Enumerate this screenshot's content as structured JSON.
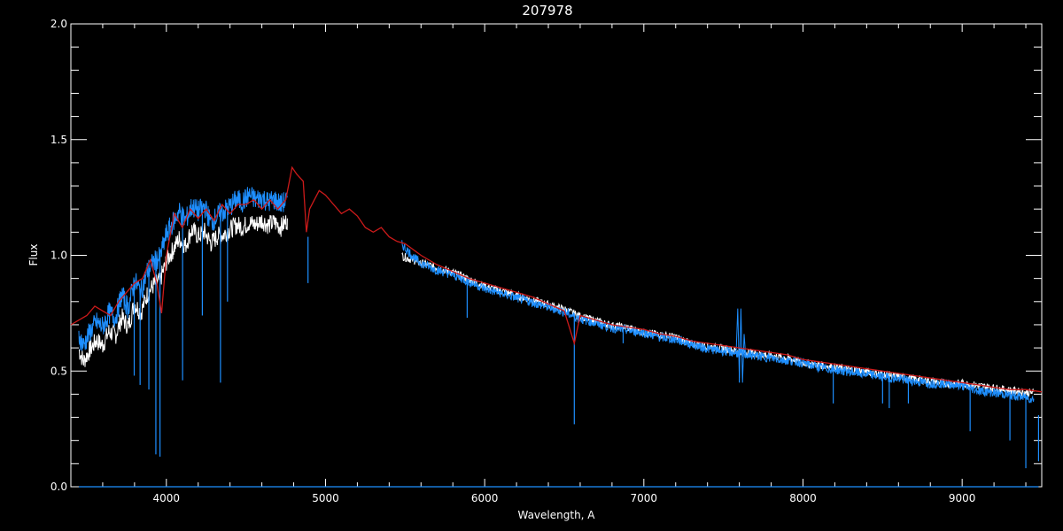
{
  "chart_data": {
    "type": "line",
    "title": "207978",
    "xlabel": "Wavelength, A",
    "ylabel": "Flux",
    "xlim": [
      3400,
      9500
    ],
    "ylim": [
      0.0,
      2.0
    ],
    "x_ticks": [
      4000,
      5000,
      6000,
      7000,
      8000,
      9000
    ],
    "x_tick_labels": [
      "4000",
      "5000",
      "6000",
      "7000",
      "8000",
      "9000"
    ],
    "y_ticks": [
      0.0,
      0.5,
      1.0,
      1.5,
      2.0
    ],
    "y_tick_labels": [
      "0.0",
      "0.5",
      "1.0",
      "1.5",
      "2.0"
    ],
    "grid": false,
    "background": "#000000",
    "series": [
      {
        "color": "#ffffff",
        "segments": [
          [
            [
              3450,
              0.6
            ],
            [
              3480,
              0.55
            ],
            [
              3520,
              0.6
            ],
            [
              3560,
              0.64
            ],
            [
              3600,
              0.62
            ],
            [
              3640,
              0.68
            ],
            [
              3680,
              0.66
            ],
            [
              3720,
              0.74
            ],
            [
              3760,
              0.7
            ],
            [
              3800,
              0.8
            ],
            [
              3840,
              0.76
            ],
            [
              3880,
              0.84
            ],
            [
              3920,
              0.88
            ],
            [
              3960,
              0.9
            ],
            [
              4000,
              0.98
            ],
            [
              4040,
              1.03
            ],
            [
              4080,
              1.08
            ],
            [
              4120,
              1.05
            ],
            [
              4160,
              1.12
            ],
            [
              4200,
              1.09
            ],
            [
              4240,
              1.11
            ],
            [
              4280,
              1.06
            ],
            [
              4320,
              1.09
            ],
            [
              4360,
              1.1
            ],
            [
              4400,
              1.12
            ],
            [
              4440,
              1.14
            ],
            [
              4480,
              1.13
            ],
            [
              4520,
              1.15
            ],
            [
              4560,
              1.14
            ],
            [
              4600,
              1.16
            ],
            [
              4640,
              1.14
            ],
            [
              4680,
              1.15
            ],
            [
              4720,
              1.13
            ],
            [
              4760,
              1.16
            ]
          ],
          [
            [
              5480,
              1.0
            ],
            [
              5520,
              0.99
            ],
            [
              5560,
              0.98
            ],
            [
              5600,
              0.97
            ],
            [
              5700,
              0.95
            ],
            [
              5800,
              0.93
            ],
            [
              5900,
              0.9
            ],
            [
              6000,
              0.87
            ],
            [
              6100,
              0.85
            ],
            [
              6200,
              0.83
            ],
            [
              6300,
              0.81
            ],
            [
              6400,
              0.79
            ],
            [
              6500,
              0.77
            ],
            [
              6600,
              0.74
            ],
            [
              6700,
              0.72
            ],
            [
              6800,
              0.7
            ],
            [
              6900,
              0.69
            ],
            [
              7000,
              0.67
            ],
            [
              7100,
              0.66
            ],
            [
              7200,
              0.65
            ],
            [
              7300,
              0.62
            ],
            [
              7400,
              0.61
            ],
            [
              7500,
              0.6
            ],
            [
              7600,
              0.59
            ],
            [
              7700,
              0.58
            ],
            [
              7800,
              0.57
            ],
            [
              7900,
              0.56
            ],
            [
              8000,
              0.54
            ],
            [
              8100,
              0.53
            ],
            [
              8200,
              0.52
            ],
            [
              8300,
              0.51
            ],
            [
              8400,
              0.5
            ],
            [
              8500,
              0.49
            ],
            [
              8600,
              0.48
            ],
            [
              8700,
              0.47
            ],
            [
              8800,
              0.46
            ],
            [
              8900,
              0.45
            ],
            [
              9000,
              0.45
            ],
            [
              9100,
              0.44
            ],
            [
              9200,
              0.43
            ],
            [
              9300,
              0.42
            ],
            [
              9400,
              0.41
            ],
            [
              9450,
              0.41
            ]
          ]
        ]
      },
      {
        "color": "#1e8fff",
        "segments": [
          [
            [
              3450,
              0.66
            ],
            [
              3480,
              0.62
            ],
            [
              3520,
              0.68
            ],
            [
              3560,
              0.72
            ],
            [
              3600,
              0.7
            ],
            [
              3640,
              0.76
            ],
            [
              3680,
              0.74
            ],
            [
              3720,
              0.84
            ],
            [
              3760,
              0.78
            ],
            [
              3800,
              0.9
            ],
            [
              3840,
              0.85
            ],
            [
              3880,
              0.94
            ],
            [
              3920,
              0.98
            ],
            [
              3960,
              1.0
            ],
            [
              4000,
              1.1
            ],
            [
              4040,
              1.15
            ],
            [
              4080,
              1.2
            ],
            [
              4120,
              1.16
            ],
            [
              4160,
              1.22
            ],
            [
              4200,
              1.2
            ],
            [
              4240,
              1.22
            ],
            [
              4280,
              1.15
            ],
            [
              4320,
              1.18
            ],
            [
              4360,
              1.2
            ],
            [
              4400,
              1.22
            ],
            [
              4440,
              1.25
            ],
            [
              4480,
              1.24
            ],
            [
              4520,
              1.27
            ],
            [
              4560,
              1.25
            ],
            [
              4600,
              1.26
            ],
            [
              4640,
              1.24
            ],
            [
              4680,
              1.25
            ],
            [
              4720,
              1.23
            ],
            [
              4760,
              1.25
            ]
          ],
          [
            [
              5480,
              1.05
            ],
            [
              5520,
              1.02
            ],
            [
              5560,
              0.99
            ],
            [
              5600,
              0.97
            ],
            [
              5700,
              0.94
            ],
            [
              5800,
              0.92
            ],
            [
              5900,
              0.89
            ],
            [
              6000,
              0.86
            ],
            [
              6100,
              0.84
            ],
            [
              6200,
              0.82
            ],
            [
              6300,
              0.8
            ],
            [
              6400,
              0.78
            ],
            [
              6500,
              0.76
            ],
            [
              6560,
              0.74
            ],
            [
              6600,
              0.73
            ],
            [
              6700,
              0.71
            ],
            [
              6800,
              0.69
            ],
            [
              6900,
              0.68
            ],
            [
              7000,
              0.67
            ],
            [
              7100,
              0.65
            ],
            [
              7200,
              0.64
            ],
            [
              7300,
              0.62
            ],
            [
              7400,
              0.6
            ],
            [
              7500,
              0.59
            ],
            [
              7600,
              0.58
            ],
            [
              7700,
              0.57
            ],
            [
              7800,
              0.56
            ],
            [
              7900,
              0.55
            ],
            [
              8000,
              0.54
            ],
            [
              8100,
              0.52
            ],
            [
              8200,
              0.51
            ],
            [
              8300,
              0.5
            ],
            [
              8400,
              0.49
            ],
            [
              8500,
              0.48
            ],
            [
              8600,
              0.47
            ],
            [
              8700,
              0.46
            ],
            [
              8800,
              0.45
            ],
            [
              8900,
              0.45
            ],
            [
              9000,
              0.44
            ],
            [
              9100,
              0.42
            ],
            [
              9200,
              0.41
            ],
            [
              9300,
              0.4
            ],
            [
              9400,
              0.39
            ],
            [
              9450,
              0.38
            ]
          ]
        ],
        "dips": [
          [
            3960,
            0.13
          ],
          [
            3934,
            0.14
          ],
          [
            4102,
            0.46
          ],
          [
            4340,
            0.45
          ],
          [
            3890,
            0.42
          ],
          [
            3835,
            0.44
          ],
          [
            3798,
            0.48
          ],
          [
            4226,
            0.74
          ],
          [
            4384,
            0.8
          ],
          [
            4890,
            0.88
          ],
          [
            5890,
            0.73
          ],
          [
            6563,
            0.27
          ],
          [
            6870,
            0.62
          ],
          [
            7600,
            0.45
          ],
          [
            8190,
            0.36
          ],
          [
            8500,
            0.36
          ],
          [
            8542,
            0.34
          ],
          [
            8662,
            0.36
          ],
          [
            9050,
            0.24
          ],
          [
            9300,
            0.2
          ],
          [
            9400,
            0.08
          ],
          [
            9480,
            0.11
          ]
        ],
        "baseline": 0.0
      },
      {
        "color": "#cc1a1a",
        "points": [
          [
            3400,
            0.7
          ],
          [
            3450,
            0.72
          ],
          [
            3500,
            0.74
          ],
          [
            3550,
            0.78
          ],
          [
            3600,
            0.76
          ],
          [
            3650,
            0.74
          ],
          [
            3700,
            0.8
          ],
          [
            3750,
            0.84
          ],
          [
            3800,
            0.88
          ],
          [
            3850,
            0.9
          ],
          [
            3900,
            0.98
          ],
          [
            3940,
            0.88
          ],
          [
            3970,
            0.75
          ],
          [
            4000,
            1.0
          ],
          [
            4050,
            1.18
          ],
          [
            4100,
            1.12
          ],
          [
            4150,
            1.2
          ],
          [
            4200,
            1.16
          ],
          [
            4250,
            1.2
          ],
          [
            4300,
            1.15
          ],
          [
            4350,
            1.22
          ],
          [
            4400,
            1.18
          ],
          [
            4450,
            1.22
          ],
          [
            4500,
            1.22
          ],
          [
            4550,
            1.24
          ],
          [
            4600,
            1.2
          ],
          [
            4650,
            1.24
          ],
          [
            4700,
            1.2
          ],
          [
            4750,
            1.24
          ],
          [
            4790,
            1.38
          ],
          [
            4820,
            1.35
          ],
          [
            4860,
            1.32
          ],
          [
            4880,
            1.1
          ],
          [
            4900,
            1.2
          ],
          [
            4930,
            1.24
          ],
          [
            4960,
            1.28
          ],
          [
            5000,
            1.26
          ],
          [
            5050,
            1.22
          ],
          [
            5100,
            1.18
          ],
          [
            5150,
            1.2
          ],
          [
            5200,
            1.17
          ],
          [
            5250,
            1.12
          ],
          [
            5300,
            1.1
          ],
          [
            5350,
            1.12
          ],
          [
            5400,
            1.08
          ],
          [
            5450,
            1.06
          ],
          [
            5500,
            1.05
          ],
          [
            5600,
            1.0
          ],
          [
            5700,
            0.96
          ],
          [
            5800,
            0.93
          ],
          [
            5900,
            0.9
          ],
          [
            6000,
            0.88
          ],
          [
            6100,
            0.86
          ],
          [
            6200,
            0.84
          ],
          [
            6300,
            0.82
          ],
          [
            6400,
            0.79
          ],
          [
            6500,
            0.76
          ],
          [
            6563,
            0.62
          ],
          [
            6600,
            0.74
          ],
          [
            6700,
            0.72
          ],
          [
            6800,
            0.7
          ],
          [
            6900,
            0.69
          ],
          [
            7000,
            0.68
          ],
          [
            7100,
            0.66
          ],
          [
            7200,
            0.65
          ],
          [
            7300,
            0.63
          ],
          [
            7400,
            0.62
          ],
          [
            7500,
            0.61
          ],
          [
            7600,
            0.6
          ],
          [
            7700,
            0.59
          ],
          [
            7800,
            0.58
          ],
          [
            7900,
            0.57
          ],
          [
            8000,
            0.55
          ],
          [
            8100,
            0.54
          ],
          [
            8200,
            0.53
          ],
          [
            8300,
            0.52
          ],
          [
            8400,
            0.51
          ],
          [
            8500,
            0.5
          ],
          [
            8600,
            0.49
          ],
          [
            8700,
            0.48
          ],
          [
            8800,
            0.47
          ],
          [
            8900,
            0.46
          ],
          [
            9000,
            0.45
          ],
          [
            9100,
            0.44
          ],
          [
            9200,
            0.43
          ],
          [
            9300,
            0.42
          ],
          [
            9400,
            0.42
          ],
          [
            9500,
            0.41
          ]
        ]
      }
    ]
  }
}
